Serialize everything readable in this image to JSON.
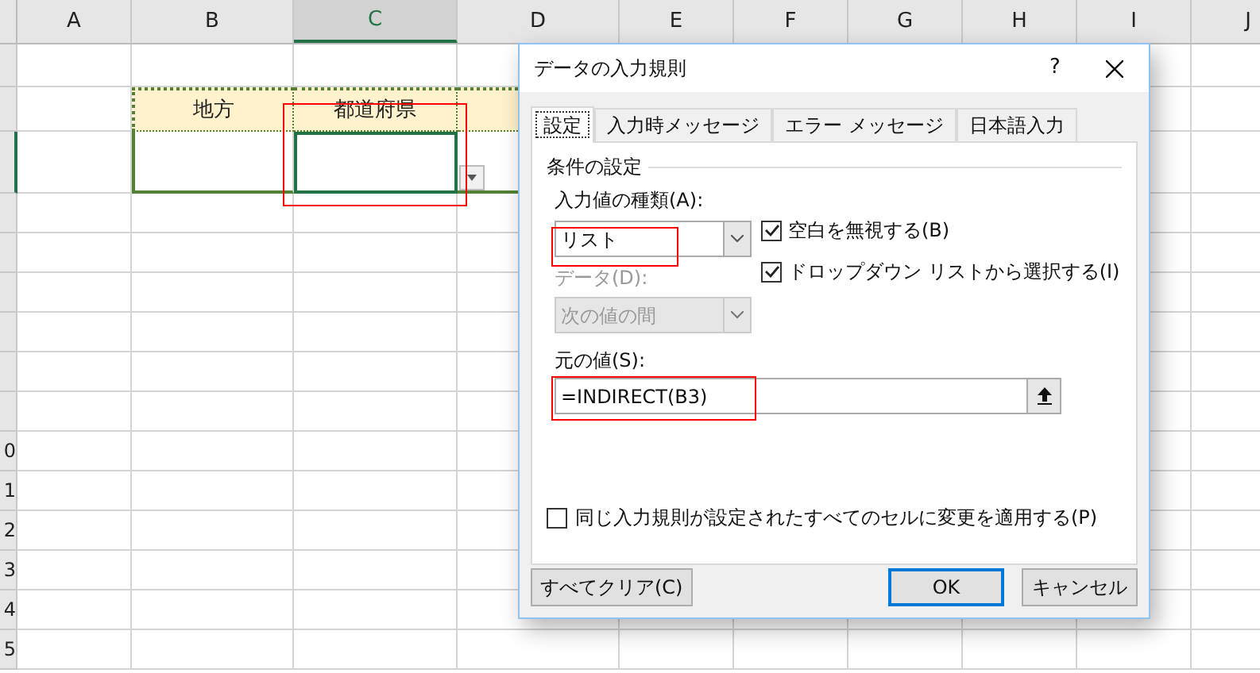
{
  "sheet": {
    "columns": [
      {
        "label": "A",
        "selected": false
      },
      {
        "label": "B",
        "selected": false
      },
      {
        "label": "C",
        "selected": true
      },
      {
        "label": "D",
        "selected": false
      },
      {
        "label": "E",
        "selected": false
      },
      {
        "label": "F",
        "selected": false
      },
      {
        "label": "G",
        "selected": false
      },
      {
        "label": "H",
        "selected": false
      },
      {
        "label": "I",
        "selected": false
      },
      {
        "label": "J",
        "selected": false
      }
    ],
    "row_number_fragments": [
      "0",
      "1",
      "2",
      "3",
      "4",
      "5"
    ],
    "table": {
      "headers": [
        "地方",
        "都道府県"
      ],
      "active_cell_dropdown": true
    }
  },
  "dialog": {
    "title": "データの入力規則",
    "help": "?",
    "tabs": [
      {
        "label": "設定",
        "selected": true
      },
      {
        "label": "入力時メッセージ",
        "selected": false
      },
      {
        "label": "エラー メッセージ",
        "selected": false
      },
      {
        "label": "日本語入力",
        "selected": false
      }
    ],
    "group": "条件の設定",
    "allow_label": "入力値の種類(A):",
    "allow_value": "リスト",
    "data_label": "データ(D):",
    "data_value": "次の値の間",
    "data_disabled": true,
    "options": [
      {
        "label": "空白を無視する(B)",
        "checked": true
      },
      {
        "label": "ドロップダウン リストから選択する(I)",
        "checked": true
      }
    ],
    "source_label": "元の値(S):",
    "source_value": "=INDIRECT(B3)",
    "apply_all": {
      "label": "同じ入力規則が設定されたすべてのセルに変更を適用する(P)",
      "checked": false
    },
    "buttons": [
      {
        "label": "すべてクリア(C)",
        "default": false
      },
      {
        "label": "OK",
        "default": true
      },
      {
        "label": "キャンセル",
        "default": false
      }
    ]
  }
}
